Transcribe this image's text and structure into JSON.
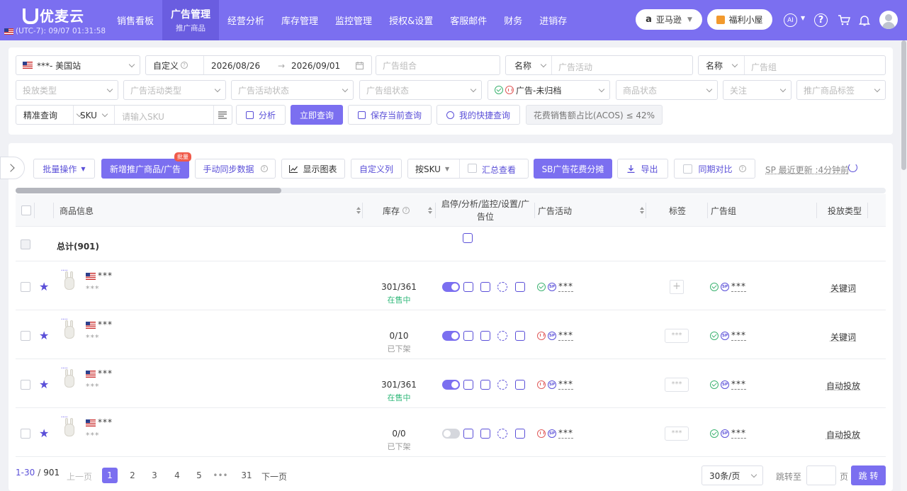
{
  "app": {
    "logo": "优麦云",
    "timezone": "(UTC-7): 09/07 01:31:58",
    "store_button": "亚马逊",
    "gift_button": "福利小屋",
    "ai_label": "AI"
  },
  "nav": [
    {
      "label": "销售看板",
      "sub": ""
    },
    {
      "label": "广告管理",
      "sub": "推广商品"
    },
    {
      "label": "经营分析",
      "sub": ""
    },
    {
      "label": "库存管理",
      "sub": ""
    },
    {
      "label": "监控管理",
      "sub": ""
    },
    {
      "label": "授权&设置",
      "sub": ""
    },
    {
      "label": "客服邮件",
      "sub": ""
    },
    {
      "label": "财务",
      "sub": ""
    },
    {
      "label": "进销存",
      "sub": ""
    }
  ],
  "filters": {
    "site": "***- 美国站",
    "date_mode": "自定义",
    "date_start": "2026/08/26",
    "date_arrow": "→",
    "date_end": "2026/09/01",
    "ad_portfolio_ph": "广告组合",
    "name1": "名称",
    "campaign_ph": "广告活动",
    "name2": "名称",
    "adgroup_ph": "广告组",
    "targeting_type_ph": "投放类型",
    "campaign_type_ph": "广告活动类型",
    "campaign_status_ph": "广告活动状态",
    "adgroup_status_ph": "广告组状态",
    "ad_status": "广告-未归档",
    "product_status_ph": "商品状态",
    "follow_ph": "关注",
    "product_tag_ph": "推广商品标签",
    "match_mode": "精准查询",
    "field": "SKU",
    "sku_ph": "请输入SKU",
    "analyze": "分析",
    "query_now": "立即查询",
    "save_query": "保存当前查询",
    "my_queries": "我的快捷查询",
    "acos_chip": "花费销售额占比(ACOS) ≤ 42%"
  },
  "toolbar": {
    "batch": "批量操作",
    "add_ad": "新增推广商品/广告",
    "badge": "批量",
    "sync": "手动同步数据",
    "show_chart": "显示图表",
    "custom_cols": "自定义列",
    "group_by": "按SKU",
    "summary": "汇总查看",
    "sb_split": "SB广告花费分摊",
    "export": "导出",
    "compare": "同期对比",
    "last_update": "SP 最近更新 :4分钟前"
  },
  "table": {
    "headers": {
      "product": "商品信息",
      "stock": "库存",
      "actions": "启停/分析/监控/设置/广告位",
      "campaign": "广告活动",
      "tag": "标签",
      "adgroup": "广告组",
      "targeting": "投放类型"
    },
    "total_label": "总计(901)",
    "rows": [
      {
        "title": "***",
        "sku": "***",
        "stock": "301/361",
        "status": "在售中",
        "status_color": "#30b87a",
        "enabled": true,
        "campaign_state": "active",
        "campaign": "***",
        "tag": "+",
        "adgroup": "***",
        "targeting": "关键词"
      },
      {
        "title": "***",
        "sku": "***",
        "stock": "0/10",
        "status": "已下架",
        "status_color": "#999999",
        "enabled": true,
        "campaign_state": "paused",
        "campaign": "***",
        "tag": "***",
        "adgroup": "***",
        "targeting": "关键词"
      },
      {
        "title": "***",
        "sku": "***",
        "stock": "301/361",
        "status": "在售中",
        "status_color": "#30b87a",
        "enabled": true,
        "campaign_state": "paused",
        "campaign": "***",
        "tag": "***",
        "adgroup": "***",
        "targeting": "自动投放"
      },
      {
        "title": "***",
        "sku": "***",
        "stock": "0/0",
        "status": "已下架",
        "status_color": "#999999",
        "enabled": false,
        "campaign_state": "paused",
        "campaign": "***",
        "tag": "***",
        "adgroup": "***",
        "targeting": "自动投放"
      }
    ],
    "sp_icon_text": "SP",
    "thumb_text": "••••"
  },
  "pagination": {
    "range": "1-30",
    "total": "901",
    "prev": "上一页",
    "pages": [
      "1",
      "2",
      "3",
      "4",
      "5",
      "•••",
      "31"
    ],
    "next": "下一页",
    "per_page": "30条/页",
    "jump_label": "跳转至",
    "page_unit": "页",
    "go": "跳 转"
  },
  "colors": {
    "accent": "#7b6ff0",
    "accent_dark": "#5a4fd8",
    "success": "#30b87a",
    "danger": "#e05a5a"
  }
}
